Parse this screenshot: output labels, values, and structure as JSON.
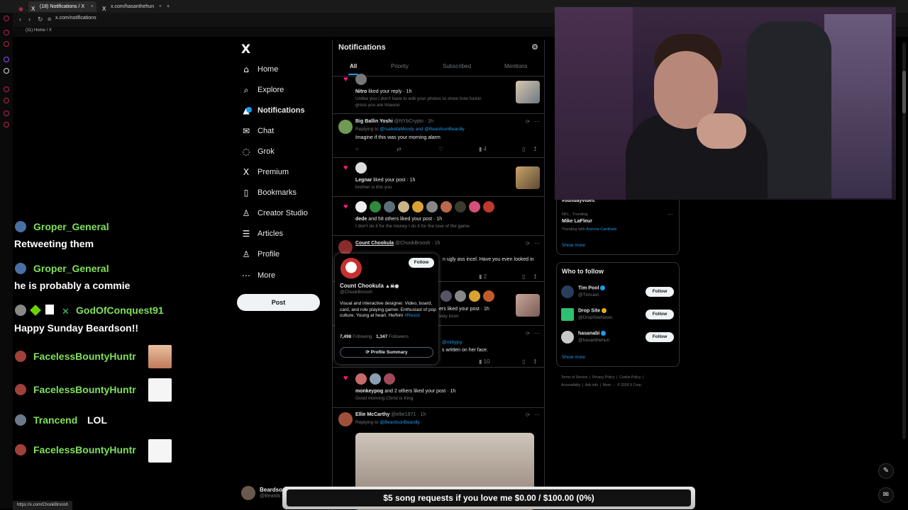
{
  "browser": {
    "tabs": [
      {
        "title": "(18) Notifications / X"
      },
      {
        "title": "x.com/hasanthehun"
      }
    ],
    "url": "x.com/notifications",
    "bookmark": "(11) Home / X",
    "status_url": "https://x.com/ChookBroosh"
  },
  "sidebar": {
    "items": [
      {
        "label": "Home",
        "icon": "home-icon",
        "glyph": "⌂"
      },
      {
        "label": "Explore",
        "icon": "search-icon",
        "glyph": "⌕"
      },
      {
        "label": "Notifications",
        "icon": "bell-icon",
        "glyph": "♪"
      },
      {
        "label": "Chat",
        "icon": "chat-icon",
        "glyph": "✉"
      },
      {
        "label": "Grok",
        "icon": "grok-icon",
        "glyph": "◌"
      },
      {
        "label": "Premium",
        "icon": "x-icon",
        "glyph": "X"
      },
      {
        "label": "Bookmarks",
        "icon": "bookmark-icon",
        "glyph": "▯"
      },
      {
        "label": "Creator Studio",
        "icon": "person-icon",
        "glyph": "♙"
      },
      {
        "label": "Articles",
        "icon": "article-icon",
        "glyph": "☰"
      },
      {
        "label": "Profile",
        "icon": "profile-icon",
        "glyph": "♙"
      },
      {
        "label": "More",
        "icon": "more-icon",
        "glyph": "⋯"
      }
    ],
    "post_label": "Post",
    "account_name": "Beardson",
    "account_handle": "@Beards"
  },
  "main": {
    "title": "Notifications",
    "tabs": [
      "All",
      "Priority",
      "Subscribed",
      "Mentions"
    ],
    "n1": {
      "name": "Nitro",
      "action": "liked your reply · 1h",
      "sub1": "Unlike you I don't have to edit your photos to show how fuckin",
      "sub2": "gross you are lmaooo"
    },
    "t1": {
      "name": "Big Ballin Yoshi",
      "handle": "@NYbCrypto · 1h",
      "reply_prefix": "Replying to",
      "reply_to": "@IsabellaMoody and @BeardsonBeardly",
      "text": "Imagine if this was your morning alarm",
      "views": "4"
    },
    "n2": {
      "name": "Legnar",
      "action": "liked your post · 1h",
      "sub": "brother is this you"
    },
    "n3": {
      "name": "dede",
      "action": "and 58 others liked your post · 1h",
      "sub": "I don't do it for the money I do it for the love of the game"
    },
    "t2": {
      "name": "Count Chookula",
      "handle": "@ChookBroosh · 1h",
      "text_tail": "n ugly ass incel. Have you even looked in",
      "views": "2"
    },
    "n4": {
      "action_tail": "ers liked your post · 1h",
      "sub_tail": "stay incel"
    },
    "t3": {
      "reply_tail": "@mittyjoy",
      "text_tail": "s written on her face.",
      "views": "10"
    },
    "n5": {
      "name": "monkeypog",
      "action": "and 2 others liked your post · 1h",
      "sub": "Good morning Christ is King"
    },
    "t4": {
      "name": "Ellie McCarthy",
      "handle": "@ellie1971 · 1h",
      "reply_prefix": "Replying to",
      "reply_to": "@BeardsonBeardly"
    }
  },
  "hovercard": {
    "follow_label": "Follow",
    "name": "Count Chookula",
    "handle": "@ChookBroosh",
    "bio": "Visual and interactive designer. Video, board, card, and role playing gamer. Enthusiast of pop culture. Young at heart. He/him",
    "tag": "#Resist",
    "following_count": "7,498",
    "following_label": "Following",
    "followers_count": "1,347",
    "followers_label": "Followers",
    "summary_label": "Profile Summary"
  },
  "right": {
    "trend_top": "#sundayvibes",
    "trend_cat": "NFL · Trending",
    "trend_name": "Mike LaFleur",
    "trend_sub": "Trending with",
    "trend_sub_link": "Arizona Cardinals",
    "show_more": "Show more",
    "wtf_title": "Who to follow",
    "wtf": [
      {
        "name": "Tim Pool",
        "handle": "@Timcast",
        "follow": "Follow",
        "color": "#2a3d5c"
      },
      {
        "name": "Drop Site",
        "handle": "@DropSiteNews",
        "follow": "Follow",
        "color": "#2fbf71"
      },
      {
        "name": "hasanabi",
        "handle": "@hasanthehun",
        "follow": "Follow",
        "color": "#c8c8c8"
      }
    ],
    "wtf_more": "Show more",
    "footer": [
      "Terms of Service",
      "Privacy Policy",
      "Cookie Policy",
      "Accessibility",
      "Ads info",
      "More ···",
      "© 2026 X Corp."
    ]
  },
  "chat": [
    {
      "name": "Groper_General",
      "text": "Retweeting them"
    },
    {
      "name": "Groper_General",
      "text": "he is probably a commie"
    },
    {
      "name": "GodOfConquest91",
      "text": "Happy Sunday Beardson!!"
    },
    {
      "name": "FacelessBountyHuntr"
    },
    {
      "name": "FacelessBountyHuntr"
    },
    {
      "name": "Trancend",
      "text": "LOL"
    },
    {
      "name": "FacelessBountyHuntr"
    }
  ],
  "songbar": {
    "text": "$5 song requests if you love me $0.00 / $100.00 (0%)",
    "progress_pct": 0
  },
  "colors": {
    "accent": "#1d9bf0",
    "like": "#f91880",
    "chat_name": "#7fe05a"
  }
}
